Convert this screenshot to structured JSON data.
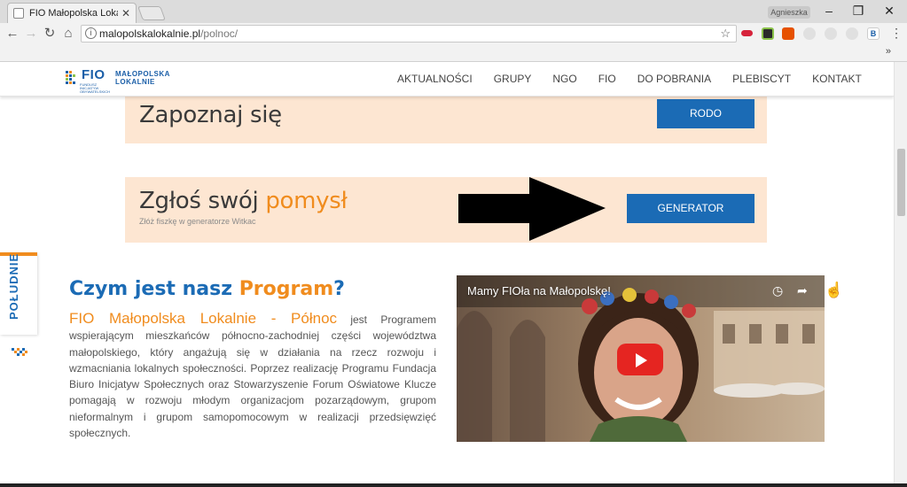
{
  "browser": {
    "tab_title": "FIO Małopolska Lokalnie",
    "tab_close": "✕",
    "profile_name": "Agnieszka",
    "url_host": "malopolskalokalnie.pl",
    "url_path": "/polnoc/",
    "window_controls": [
      "–",
      "❐",
      "✕"
    ],
    "bookmarks_more": "»"
  },
  "site": {
    "logo": {
      "mark": "FIO",
      "small_text": "FUNDUSZ INICJATYW OBYWATELSKICH",
      "brand_line1": "MAŁOPOLSKA",
      "brand_line2": "LOKALNIE"
    },
    "menu": [
      "AKTUALNOŚCI",
      "GRUPY",
      "NGO",
      "FIO",
      "DO POBRANIA",
      "PLEBISCYT",
      "KONTAKT"
    ]
  },
  "banner_rodo": {
    "title": "Zapoznaj się",
    "button": "RODO"
  },
  "banner_generator": {
    "title_plain": "Zgłoś swój ",
    "title_accent": "pomysł",
    "subtitle": "Złóż fiszkę w generatorze Witkac",
    "button": "GENERATOR"
  },
  "side_tab": {
    "label": "POŁUDNIE"
  },
  "program": {
    "title_plain": "Czym jest nasz ",
    "title_accent": "Program",
    "title_end": "?",
    "lead_highlight": "FIO Małopolska Lokalnie - Północ",
    "lead_text": " jest Programem wspierającym mieszkańców północno-zachodniej części województwa małopolskiego, który angażują się w działania na rzecz rozwoju i wzmacniania lokalnych społeczności. Poprzez realizację Programu Fundacja Biuro Inicjatyw Społecznych oraz Stowarzyszenie Forum Oświatowe Klucze pomagają w rozwoju młodym organizacjom pozarządowym, grupom nieformalnym i grupom samopomocowym w realizacji przedsięwzięć społecznych."
  },
  "video": {
    "title": "Mamy FIOła na Małopolskę!"
  },
  "colors": {
    "accent_orange": "#f08c1e",
    "brand_blue": "#1b6bb5",
    "banner_bg": "#fde6d2",
    "youtube_red": "#e52521"
  }
}
